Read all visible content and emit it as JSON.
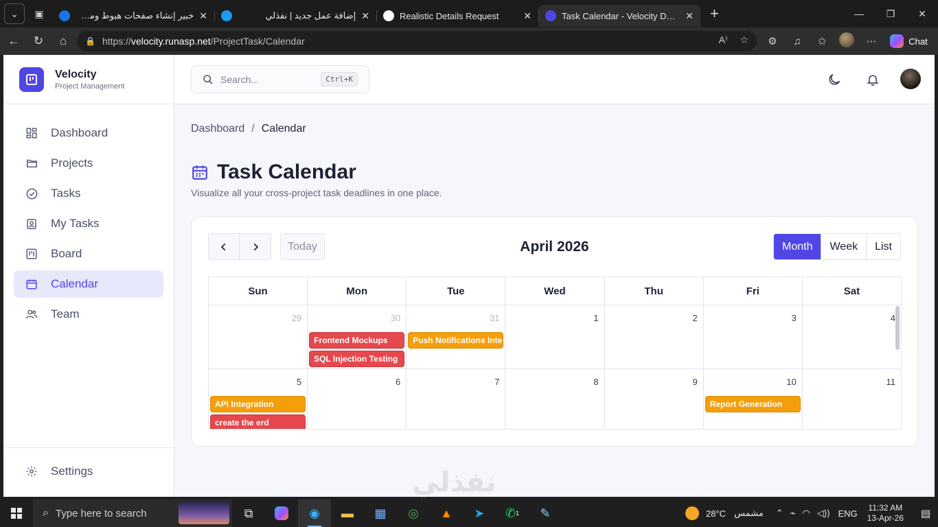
{
  "browser": {
    "tabs": [
      {
        "title": "خبير إنشاء صفحات هبوط ومسارات بيع",
        "rtl": true,
        "favicon_color": "#1a73e8",
        "active": false
      },
      {
        "title": "إضافة عمل جديد | نفذلي",
        "rtl": true,
        "favicon_color": "#1d9bf0",
        "active": false
      },
      {
        "title": "Realistic Details Request",
        "rtl": false,
        "favicon_color": "#ffffff",
        "active": false
      },
      {
        "title": "Task Calendar - Velocity Dashboard",
        "rtl": false,
        "favicon_color": "#4f46e5",
        "active": true
      }
    ],
    "url_prefix": "https://",
    "url_host": "velocity.runasp.net",
    "url_path": "/ProjectTask/Calendar",
    "chat_label": "Chat"
  },
  "sidebar": {
    "brand_name": "Velocity",
    "brand_sub": "Project Management",
    "items": [
      {
        "label": "Dashboard",
        "icon": "dashboard-icon",
        "active": false
      },
      {
        "label": "Projects",
        "icon": "folder-icon",
        "active": false
      },
      {
        "label": "Tasks",
        "icon": "check-circle-icon",
        "active": false
      },
      {
        "label": "My Tasks",
        "icon": "user-badge-icon",
        "active": false
      },
      {
        "label": "Board",
        "icon": "kanban-icon",
        "active": false
      },
      {
        "label": "Calendar",
        "icon": "calendar-icon",
        "active": true
      },
      {
        "label": "Team",
        "icon": "team-icon",
        "active": false
      }
    ],
    "settings_label": "Settings"
  },
  "topbar": {
    "search_placeholder": "Search...",
    "search_shortcut": "Ctrl+K"
  },
  "breadcrumb": {
    "root": "Dashboard",
    "separator": "/",
    "current": "Calendar"
  },
  "page": {
    "title": "Task Calendar",
    "subtitle": "Visualize all your cross-project task deadlines in one place."
  },
  "calendar": {
    "today_label": "Today",
    "month_title": "April 2026",
    "views": [
      {
        "label": "Month",
        "active": true
      },
      {
        "label": "Week",
        "active": false
      },
      {
        "label": "List",
        "active": false
      }
    ],
    "weekdays": [
      "Sun",
      "Mon",
      "Tue",
      "Wed",
      "Thu",
      "Fri",
      "Sat"
    ],
    "weeks": [
      [
        {
          "day": "29",
          "other": true,
          "events": []
        },
        {
          "day": "30",
          "other": true,
          "events": [
            {
              "title": "Frontend Mockups",
              "color": "red"
            },
            {
              "title": "SQL Injection Testing",
              "color": "red"
            }
          ]
        },
        {
          "day": "31",
          "other": true,
          "events": [
            {
              "title": "Push Notifications Integration",
              "color": "orange"
            }
          ]
        },
        {
          "day": "1",
          "other": false,
          "events": []
        },
        {
          "day": "2",
          "other": false,
          "events": []
        },
        {
          "day": "3",
          "other": false,
          "events": []
        },
        {
          "day": "4",
          "other": false,
          "events": []
        }
      ],
      [
        {
          "day": "5",
          "other": false,
          "events": [
            {
              "title": "API Integration",
              "color": "orange"
            },
            {
              "title": "create the erd",
              "color": "red"
            }
          ]
        },
        {
          "day": "6",
          "other": false,
          "events": []
        },
        {
          "day": "7",
          "other": false,
          "events": []
        },
        {
          "day": "8",
          "other": false,
          "events": []
        },
        {
          "day": "9",
          "other": false,
          "events": []
        },
        {
          "day": "10",
          "other": false,
          "events": [
            {
              "title": "Report Generation",
              "color": "orange"
            }
          ]
        },
        {
          "day": "11",
          "other": false,
          "events": []
        }
      ]
    ]
  },
  "taskbar": {
    "search_placeholder": "Type here to search",
    "temperature": "28°C",
    "weather": "مشمس",
    "language": "ENG",
    "time": "11:32 AM",
    "date": "13-Apr-26",
    "badge_count": "1"
  },
  "watermark": "نفذلي"
}
